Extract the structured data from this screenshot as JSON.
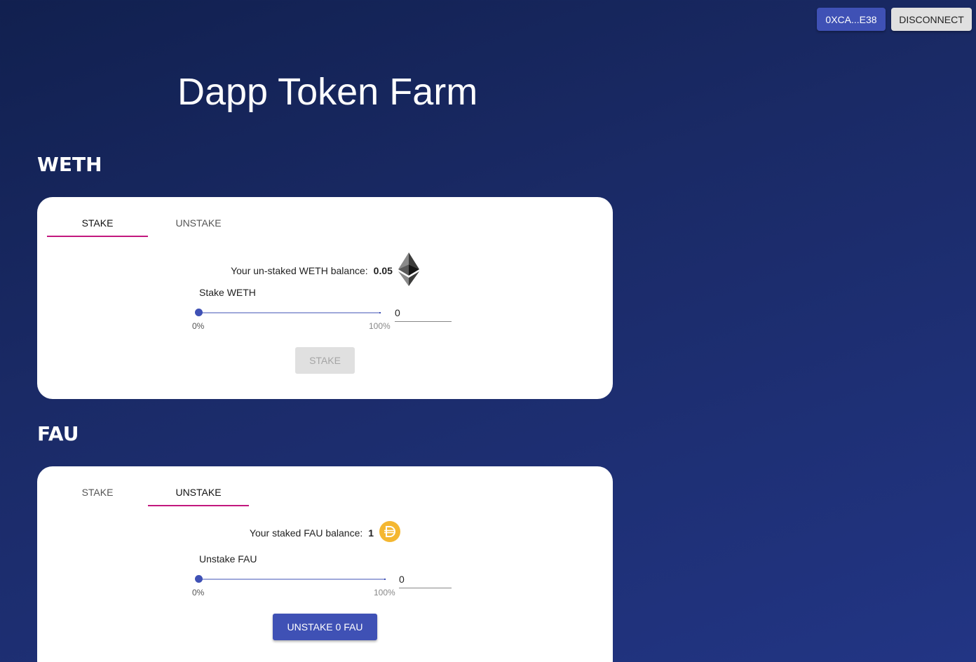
{
  "header": {
    "account_label": "0XCA...E38",
    "disconnect_label": "DISCONNECT"
  },
  "app": {
    "title": "Dapp Token Farm"
  },
  "tokens": [
    {
      "name": "WETH",
      "tabs": [
        "STAKE",
        "UNSTAKE"
      ],
      "active_tab": "STAKE",
      "balance_label": "Your un-staked WETH balance:",
      "balance_value": "0.05",
      "icon": "ethereum-icon",
      "field_label": "Stake WETH",
      "slider_min_label": "0%",
      "slider_max_label": "100%",
      "slider_percent": 0,
      "input_value": "0",
      "action_label": "STAKE",
      "action_enabled": false
    },
    {
      "name": "FAU",
      "tabs": [
        "STAKE",
        "UNSTAKE"
      ],
      "active_tab": "UNSTAKE",
      "balance_label": "Your staked FAU balance:",
      "balance_value": "1",
      "icon": "dai-coin-icon",
      "field_label": "Unstake FAU",
      "slider_min_label": "0%",
      "slider_max_label": "100%",
      "slider_percent": 0,
      "input_value": "0",
      "action_label": "UNSTAKE 0 FAU",
      "action_enabled": true
    }
  ],
  "colors": {
    "primary": "#3f51b5",
    "tab_indicator": "#c2187e",
    "dai_gold": "#f4b731"
  }
}
